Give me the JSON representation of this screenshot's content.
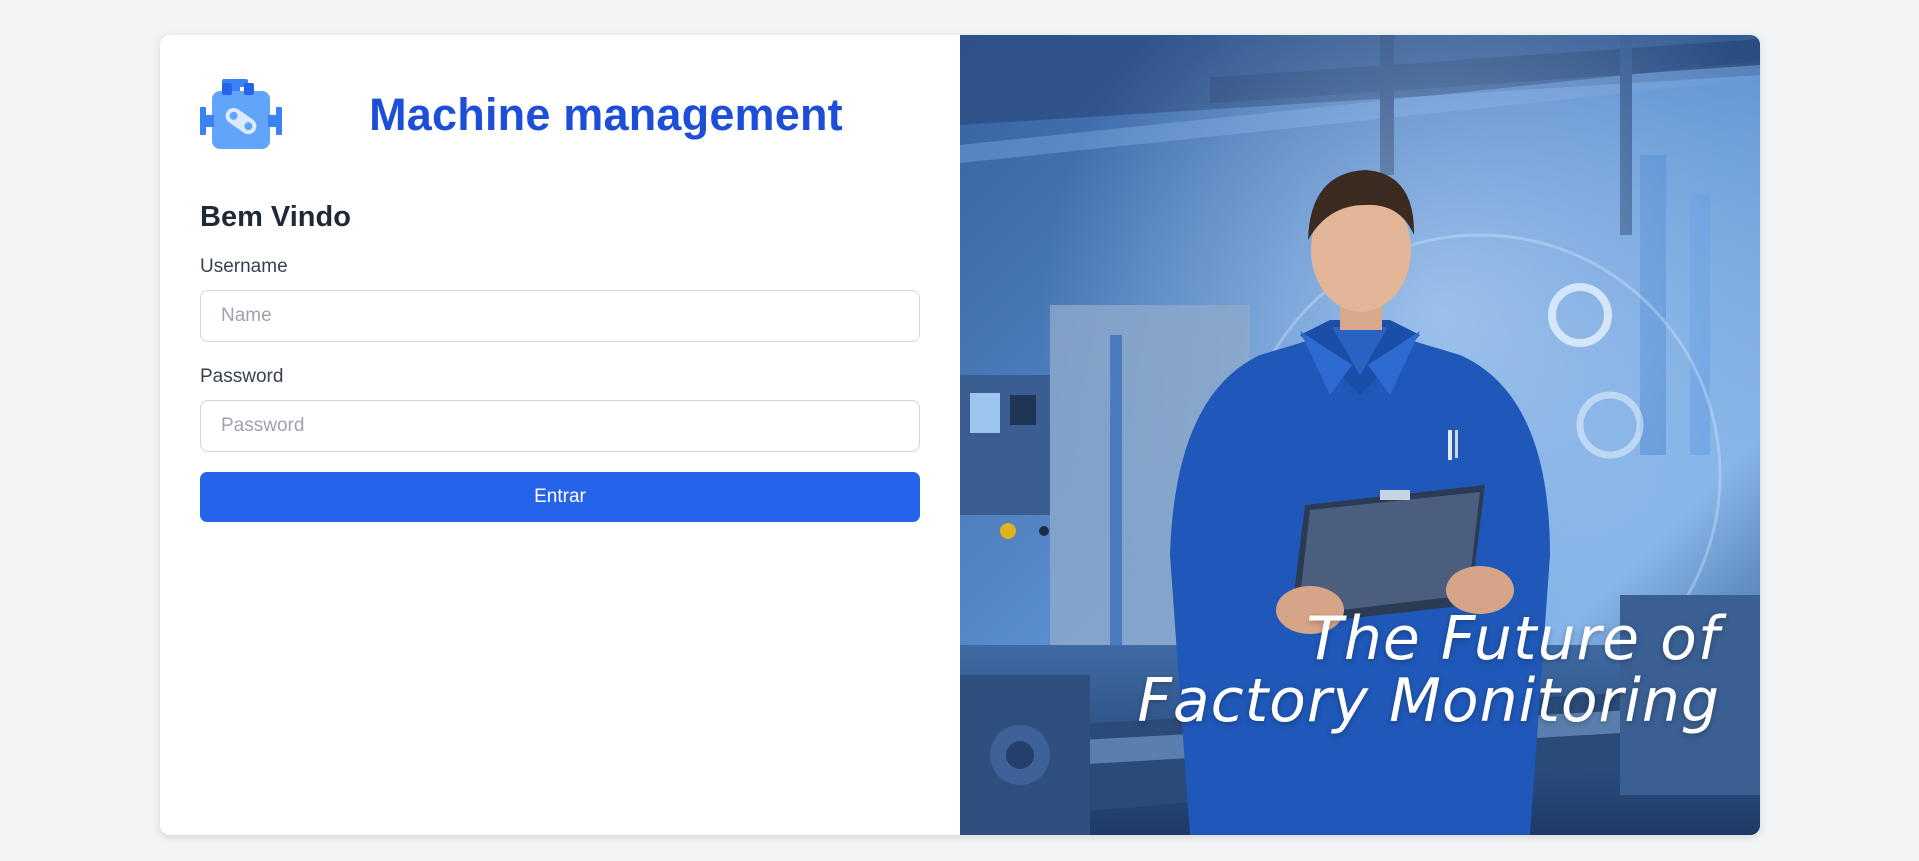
{
  "brand": {
    "title": "Machine management",
    "logo_icon": "engine-icon",
    "accent_color": "#1d4ed8"
  },
  "form": {
    "heading": "Bem Vindo",
    "username": {
      "label": "Username",
      "placeholder": "Name",
      "value": ""
    },
    "password": {
      "label": "Password",
      "placeholder": "Password",
      "value": ""
    },
    "submit_label": "Entrar",
    "button_color": "#2563eb"
  },
  "hero": {
    "line1": "The Future of",
    "line2": "Factory Monitoring",
    "image_subject": "factory-worker-with-clipboard"
  }
}
